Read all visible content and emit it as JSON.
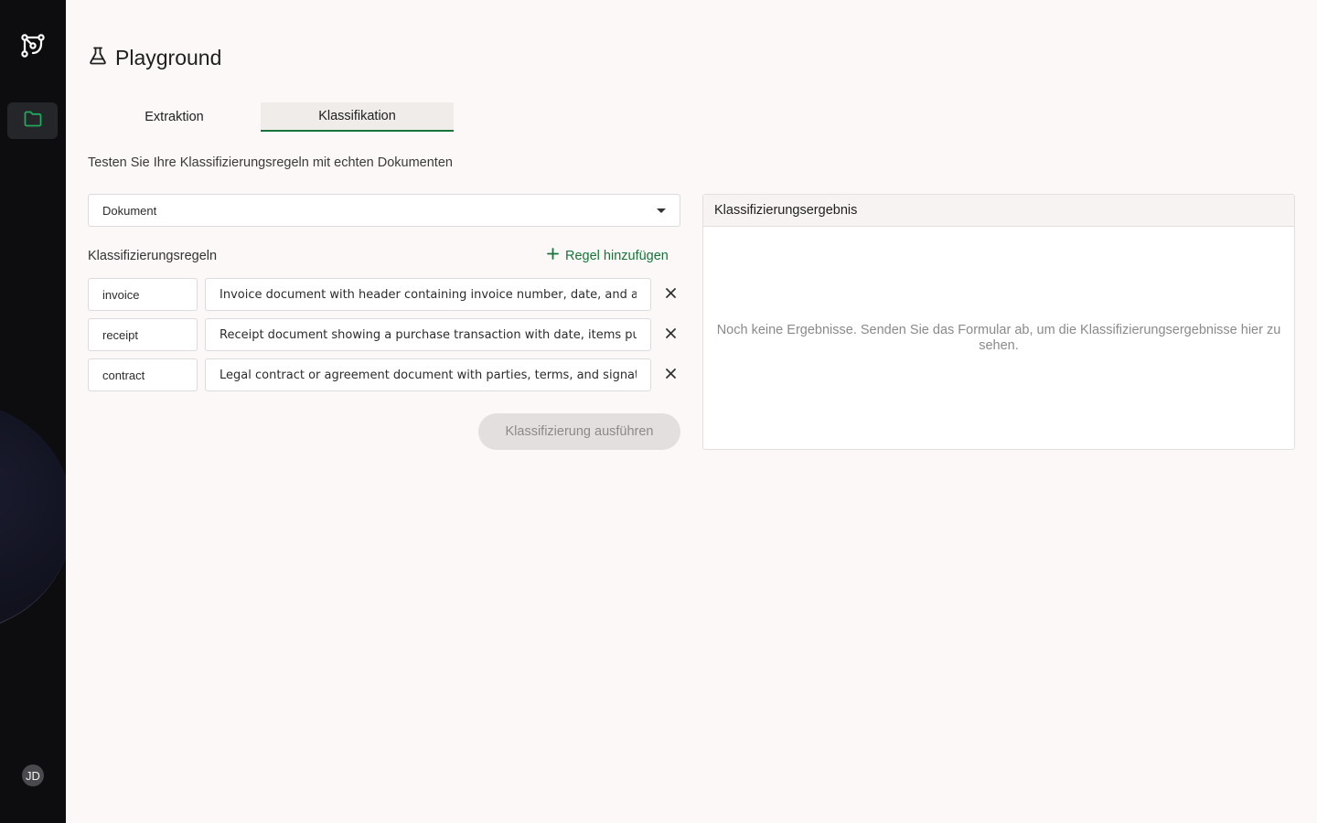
{
  "sidebar": {
    "logo_icon": "workflow-logo-icon",
    "nav_icon": "folder-icon",
    "avatar_initials": "JD",
    "accent": "#22a85a"
  },
  "page": {
    "icon": "flask-icon",
    "title": "Playground"
  },
  "tabs": [
    {
      "label": "Extraktion",
      "active": false
    },
    {
      "label": "Klassifikation",
      "active": true
    }
  ],
  "subtitle": "Testen Sie Ihre Klassifizierungsregeln mit echten Dokumenten",
  "document_select": {
    "value": "Dokument"
  },
  "rules": {
    "label": "Klassifizierungsregeln",
    "add_label": "Regel hinzufügen",
    "items": [
      {
        "name": "invoice",
        "description": "Invoice document with header containing invoice number, date, and a table"
      },
      {
        "name": "receipt",
        "description": "Receipt document showing a purchase transaction with date, items purchased"
      },
      {
        "name": "contract",
        "description": "Legal contract or agreement document with parties, terms, and signature b"
      }
    ]
  },
  "run_button": {
    "label": "Klassifizierung ausführen"
  },
  "result": {
    "title": "Klassifizierungsergebnis",
    "empty_text": "Noch keine Ergebnisse. Senden Sie das Formular ab, um die Klassifizierungsergebnisse hier zu sehen."
  },
  "colors": {
    "accent": "#17733a",
    "background": "#fbf8f7",
    "sidebar": "#0d0d0f"
  }
}
